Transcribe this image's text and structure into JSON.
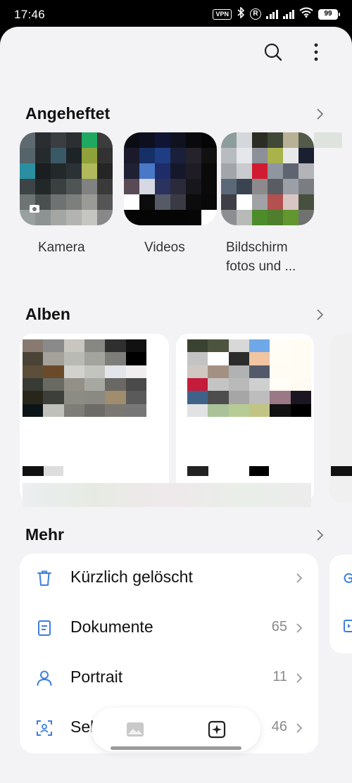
{
  "status_bar": {
    "time": "17:46",
    "vpn_label": "VPN",
    "r_label": "R",
    "battery": "99"
  },
  "toolbar": {
    "search_icon": "search-icon",
    "more_icon": "more-vertical-icon"
  },
  "sections": {
    "pinned_title": "Angeheftet",
    "albums_title": "Alben",
    "more_title": "Mehr"
  },
  "pinned": [
    {
      "label": "Kamera"
    },
    {
      "label": "Videos"
    },
    {
      "label": "Bildschirm\nfotos und ..."
    }
  ],
  "more_items": [
    {
      "label": "Kürzlich gelöscht",
      "count": "",
      "icon": "trash-icon"
    },
    {
      "label": "Dokumente",
      "count": "65",
      "icon": "document-icon"
    },
    {
      "label": "Portrait",
      "count": "11",
      "icon": "person-icon"
    },
    {
      "label": "Selfies",
      "count": "46",
      "icon": "face-scan-icon"
    }
  ],
  "bottom_bar": {
    "photos_icon": "photos-icon",
    "ai-edit-icon": "sparkle-edit-icon"
  },
  "colors": {
    "accent": "#3d7ee0",
    "background": "#f3f3f6",
    "card": "#ffffff"
  }
}
